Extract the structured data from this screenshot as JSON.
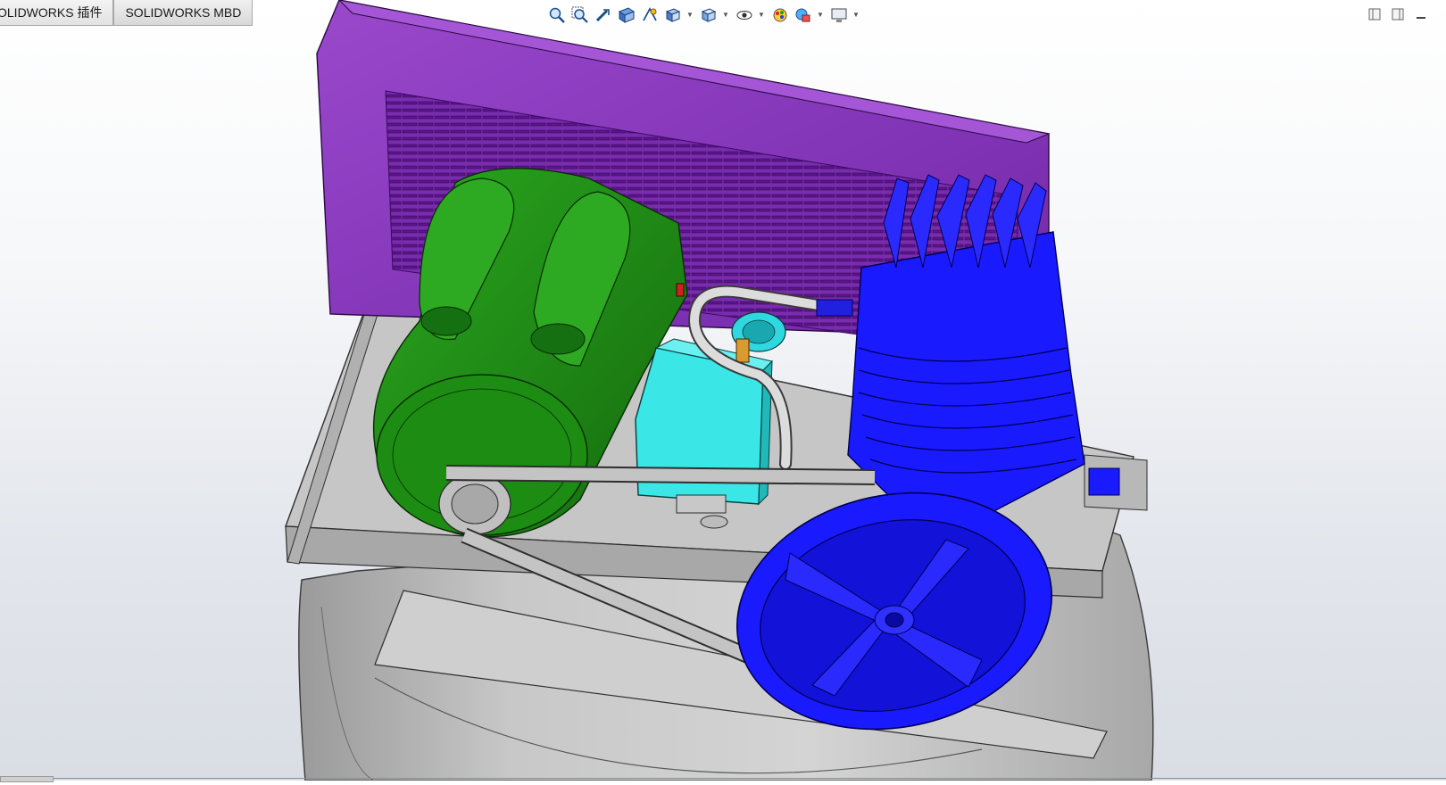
{
  "tabs": [
    {
      "label": "OLIDWORKS 插件"
    },
    {
      "label": "SOLIDWORKS MBD"
    }
  ],
  "heads_up_toolbar": {
    "tools": [
      {
        "icon": "zoom-to-fit-icon"
      },
      {
        "icon": "zoom-to-area-icon"
      },
      {
        "icon": "previous-view-icon"
      },
      {
        "icon": "section-view-icon"
      },
      {
        "icon": "dynamic-annotation-view-icon"
      },
      {
        "icon": "view-orientation-icon"
      },
      {
        "icon": "display-style-icon"
      },
      {
        "icon": "hide-show-items-icon"
      },
      {
        "icon": "edit-appearance-icon"
      },
      {
        "icon": "apply-scene-icon"
      },
      {
        "icon": "view-settings-icon"
      }
    ]
  },
  "window_controls": [
    "restore-left-icon",
    "restore-right-icon",
    "minimize-icon"
  ],
  "model": {
    "description_colors": {
      "tank": "#c8c8c8",
      "base_plate": "#c2c2c2",
      "shroud": "#8a38c0",
      "motor": "#1f8a14",
      "pressure_switch": "#30e0e0",
      "pump_head": "#1414ff",
      "belt": "#bfbfbf",
      "tubing": "#d8d8d8"
    }
  }
}
